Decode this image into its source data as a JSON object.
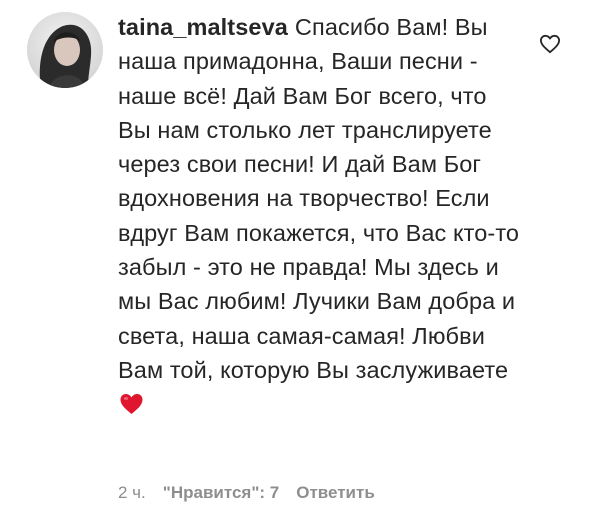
{
  "comment": {
    "username": "taina_maltseva",
    "text": "Спасибо Вам! Вы наша примадонна, Ваши песни - наше всё! Дай Вам Бог всего, что Вы нам столько лет транслируете через свои песни! И дай Вам Бог вдохновения на творчество! Если вдруг Вам покажется, что Вас кто-то забыл - это не правда! Мы здесь и мы Вас любим! Лучики Вам добра и света, наша самая-самая! Любви Вам той, которую Вы заслуживаете",
    "emoji": "red-heart",
    "time": "2 ч.",
    "likes_label": "\"Нравится\": 7",
    "reply_label": "Ответить",
    "like_icon": "heart-outline-icon",
    "heart_color": "#e0152e"
  }
}
